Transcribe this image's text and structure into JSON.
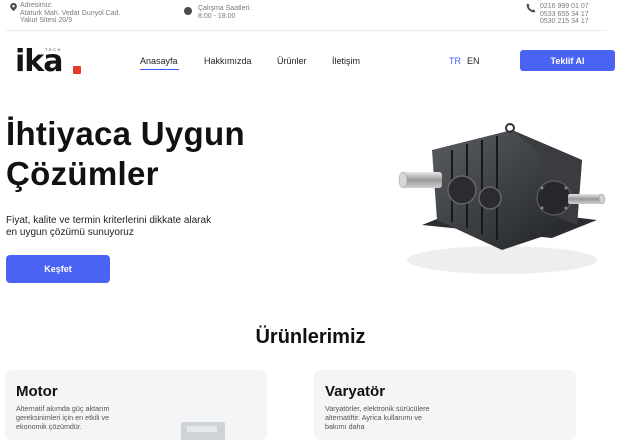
{
  "topbar": {
    "address_label": "Adresimiz:",
    "address_line1": "Ataturk Mah. Vedat Gunyol Cad.",
    "address_line2": "Yakut Sitesi 20/9",
    "hours_label": "Çalışma Saatleri:",
    "hours_value": "8:00 - 18:00",
    "phone1": "0216 999 01 07",
    "phone2": "0533 655 34 17",
    "phone3": "0530 215 34 17"
  },
  "logo": {
    "text": "ika",
    "subtext": "TECH"
  },
  "nav": {
    "items": [
      {
        "label": "Anasayfa",
        "active": true
      },
      {
        "label": "Hakkımızda",
        "active": false
      },
      {
        "label": "Ürünler",
        "active": false
      },
      {
        "label": "İletişim",
        "active": false
      }
    ],
    "lang_tr": "TR",
    "lang_en": "EN",
    "cta": "Teklif Al"
  },
  "hero": {
    "title_line1": "İhtiyaca Uygun",
    "title_line2": "Çözümler",
    "subtitle_line1": "Fiyat, kalite ve termin kriterlerini dikkate alarak",
    "subtitle_line2": "en uygun çözümü sunuyoruz",
    "button": "Keşfet"
  },
  "products": {
    "title": "Ürünlerimiz",
    "cards": [
      {
        "title": "Motor",
        "desc": "Alternatif akımda güç aktarım gereksinimleri için en etkili ve ekonomik çözümdür."
      },
      {
        "title": "Varyatör",
        "desc": "Varyatörler, elektronik sürücülere alternatiftir. Ayrica kullanımı ve bakımı daha"
      }
    ]
  },
  "colors": {
    "accent": "#4a63f5",
    "logo_dot": "#e23b2e",
    "card_bg": "#f4f5f7"
  },
  "icons": [
    "location-pin-icon",
    "clock-icon",
    "phone-icon"
  ]
}
